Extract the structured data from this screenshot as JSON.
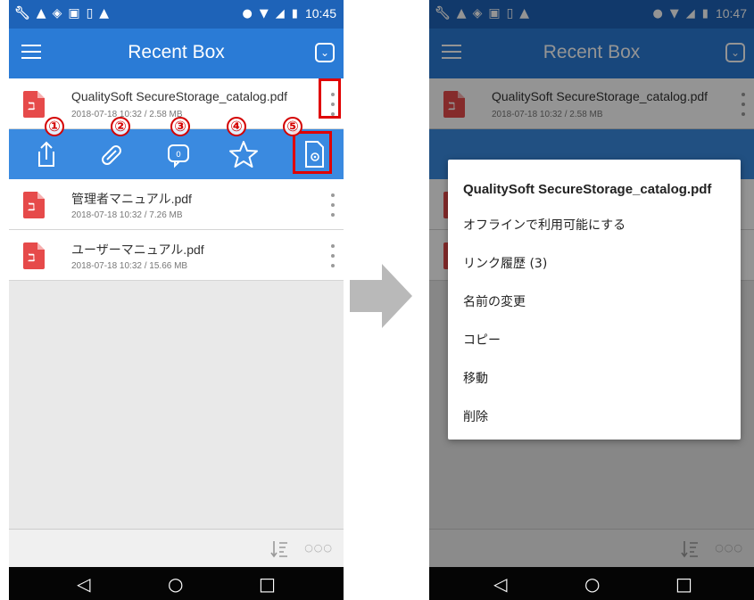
{
  "left": {
    "status_time": "10:45",
    "title": "Recent Box",
    "files": [
      {
        "name": "QualitySoft SecureStorage_catalog.pdf",
        "meta": "2018-07-18 10:32 / 2.58 MB"
      },
      {
        "name": "管理者マニュアル.pdf",
        "meta": "2018-07-18 10:32 / 7.26 MB"
      },
      {
        "name": "ユーザーマニュアル.pdf",
        "meta": "2018-07-18 10:32 / 15.66 MB"
      }
    ],
    "action_bar": {
      "items": [
        "share-icon",
        "link-icon",
        "comment-icon",
        "star-icon",
        "file-settings-icon"
      ]
    },
    "labels": [
      "①",
      "②",
      "③",
      "④",
      "⑤"
    ]
  },
  "right": {
    "status_time": "10:47",
    "title": "Recent Box",
    "files": [
      {
        "name": "QualitySoft SecureStorage_catalog.pdf",
        "meta": "2018-07-18 10:32 / 2.58 MB"
      }
    ],
    "menu": {
      "title": "QualitySoft SecureStorage_catalog.pdf",
      "items": [
        "オフラインで利用可能にする",
        "リンク履歴 (3)",
        "名前の変更",
        "コピー",
        "移動",
        "削除"
      ]
    }
  },
  "nav": {
    "back": "◁",
    "home": "○",
    "recent": "□"
  },
  "colors": {
    "appbar": "#2a7bd6",
    "statusbar": "#1e63b8",
    "action_bar": "#3a8ae0",
    "highlight": "#e00000"
  }
}
